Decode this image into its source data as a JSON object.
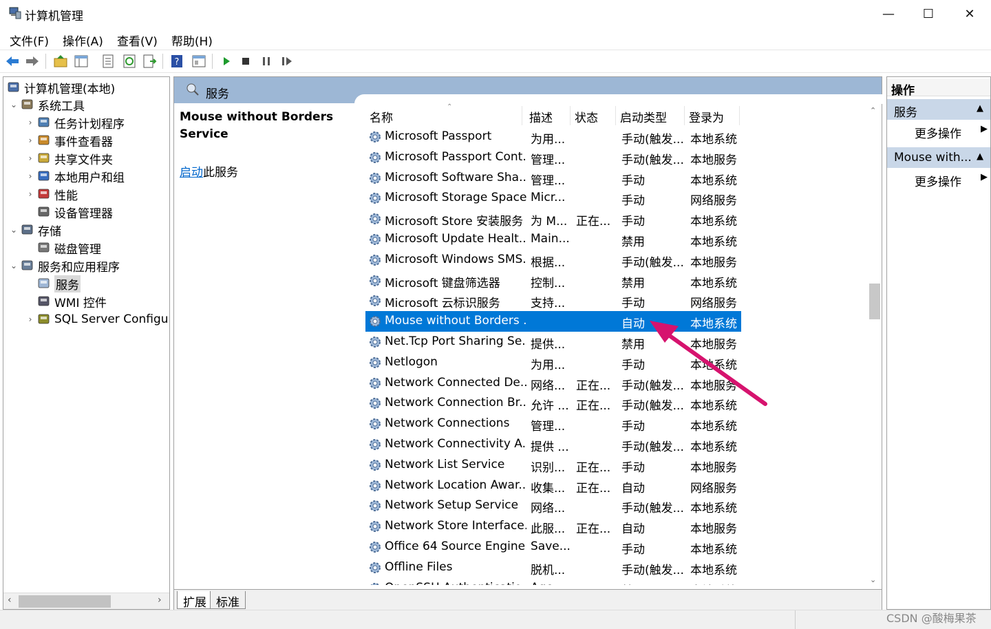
{
  "window": {
    "title": "计算机管理",
    "controls": {
      "minimize": "—",
      "maximize": "☐",
      "close": "✕"
    }
  },
  "menu": [
    "文件(F)",
    "操作(A)",
    "查看(V)",
    "帮助(H)"
  ],
  "toolbar_icons": [
    "back-arrow-icon",
    "forward-arrow-icon",
    "up-folder-icon",
    "show-hide-tree-icon",
    "properties-icon",
    "refresh-icon",
    "export-list-icon",
    "help-icon",
    "view-icon",
    "start-service-icon",
    "stop-service-icon",
    "pause-service-icon",
    "restart-service-icon"
  ],
  "tree": [
    {
      "label": "计算机管理(本地)",
      "indent": 0,
      "expander": "",
      "icon": "computer-management-icon"
    },
    {
      "label": "系统工具",
      "indent": 1,
      "expander": "⌄",
      "icon": "system-tools-icon"
    },
    {
      "label": "任务计划程序",
      "indent": 2,
      "expander": "›",
      "icon": "task-scheduler-icon"
    },
    {
      "label": "事件查看器",
      "indent": 2,
      "expander": "›",
      "icon": "event-viewer-icon"
    },
    {
      "label": "共享文件夹",
      "indent": 2,
      "expander": "›",
      "icon": "shared-folders-icon"
    },
    {
      "label": "本地用户和组",
      "indent": 2,
      "expander": "›",
      "icon": "local-users-icon"
    },
    {
      "label": "性能",
      "indent": 2,
      "expander": "›",
      "icon": "performance-icon"
    },
    {
      "label": "设备管理器",
      "indent": 2,
      "expander": "",
      "icon": "device-manager-icon"
    },
    {
      "label": "存储",
      "indent": 1,
      "expander": "⌄",
      "icon": "storage-icon"
    },
    {
      "label": "磁盘管理",
      "indent": 2,
      "expander": "",
      "icon": "disk-management-icon"
    },
    {
      "label": "服务和应用程序",
      "indent": 1,
      "expander": "⌄",
      "icon": "services-apps-icon"
    },
    {
      "label": "服务",
      "indent": 2,
      "expander": "",
      "icon": "services-icon",
      "selected": true
    },
    {
      "label": "WMI 控件",
      "indent": 2,
      "expander": "",
      "icon": "wmi-control-icon"
    },
    {
      "label": "SQL Server Configura",
      "indent": 2,
      "expander": "›",
      "icon": "sql-server-icon"
    }
  ],
  "middle": {
    "header": "服务",
    "selected_title": "Mouse without Borders Service",
    "action_link": "启动",
    "action_suffix": "此服务",
    "columns": [
      "名称",
      "描述",
      "状态",
      "启动类型",
      "登录为"
    ],
    "rows": [
      {
        "name": "Microsoft Passport",
        "desc": "为用...",
        "state": "",
        "start": "手动(触发...",
        "logon": "本地系统"
      },
      {
        "name": "Microsoft Passport Cont...",
        "desc": "管理...",
        "state": "",
        "start": "手动(触发...",
        "logon": "本地服务"
      },
      {
        "name": "Microsoft Software Sha...",
        "desc": "管理...",
        "state": "",
        "start": "手动",
        "logon": "本地系统"
      },
      {
        "name": "Microsoft Storage Space...",
        "desc": "Micr...",
        "state": "",
        "start": "手动",
        "logon": "网络服务"
      },
      {
        "name": "Microsoft Store 安装服务",
        "desc": "为 M...",
        "state": "正在...",
        "start": "手动",
        "logon": "本地系统"
      },
      {
        "name": "Microsoft Update Healt...",
        "desc": "Main...",
        "state": "",
        "start": "禁用",
        "logon": "本地系统"
      },
      {
        "name": "Microsoft Windows SMS...",
        "desc": "根据...",
        "state": "",
        "start": "手动(触发...",
        "logon": "本地服务"
      },
      {
        "name": "Microsoft 键盘筛选器",
        "desc": "控制...",
        "state": "",
        "start": "禁用",
        "logon": "本地系统"
      },
      {
        "name": "Microsoft 云标识服务",
        "desc": "支持...",
        "state": "",
        "start": "手动",
        "logon": "网络服务"
      },
      {
        "name": "Mouse without Borders ...",
        "desc": "",
        "state": "",
        "start": "自动",
        "logon": "本地系统",
        "selected": true
      },
      {
        "name": "Net.Tcp Port Sharing Se...",
        "desc": "提供...",
        "state": "",
        "start": "禁用",
        "logon": "本地服务"
      },
      {
        "name": "Netlogon",
        "desc": "为用...",
        "state": "",
        "start": "手动",
        "logon": "本地系统"
      },
      {
        "name": "Network Connected De...",
        "desc": "网络...",
        "state": "正在...",
        "start": "手动(触发...",
        "logon": "本地服务"
      },
      {
        "name": "Network Connection Br...",
        "desc": "允许 ...",
        "state": "正在...",
        "start": "手动(触发...",
        "logon": "本地系统"
      },
      {
        "name": "Network Connections",
        "desc": "管理...",
        "state": "",
        "start": "手动",
        "logon": "本地系统"
      },
      {
        "name": "Network Connectivity A...",
        "desc": "提供 ...",
        "state": "",
        "start": "手动(触发...",
        "logon": "本地系统"
      },
      {
        "name": "Network List Service",
        "desc": "识别...",
        "state": "正在...",
        "start": "手动",
        "logon": "本地服务"
      },
      {
        "name": "Network Location Awar...",
        "desc": "收集...",
        "state": "正在...",
        "start": "自动",
        "logon": "网络服务"
      },
      {
        "name": "Network Setup Service",
        "desc": "网络...",
        "state": "",
        "start": "手动(触发...",
        "logon": "本地系统"
      },
      {
        "name": "Network Store Interface...",
        "desc": "此服...",
        "state": "正在...",
        "start": "自动",
        "logon": "本地服务"
      },
      {
        "name": "Office 64 Source Engine",
        "desc": "Save...",
        "state": "",
        "start": "手动",
        "logon": "本地系统"
      },
      {
        "name": "Offline Files",
        "desc": "脱机...",
        "state": "",
        "start": "手动(触发...",
        "logon": "本地系统"
      },
      {
        "name": "OpenSSH Authenticatio...",
        "desc": "Age...",
        "state": "",
        "start": "禁用",
        "logon": "本地系统"
      }
    ],
    "tabs": [
      "扩展",
      "标准"
    ]
  },
  "actions": {
    "title": "操作",
    "groups": [
      {
        "label": "服务",
        "item": "更多操作"
      },
      {
        "label": "Mouse with...",
        "item": "更多操作"
      }
    ]
  },
  "watermark": "CSDN @酸梅果茶",
  "colors": {
    "selection": "#0078d7",
    "header": "#9db7d5",
    "annotation_arrow": "#d6136e"
  }
}
